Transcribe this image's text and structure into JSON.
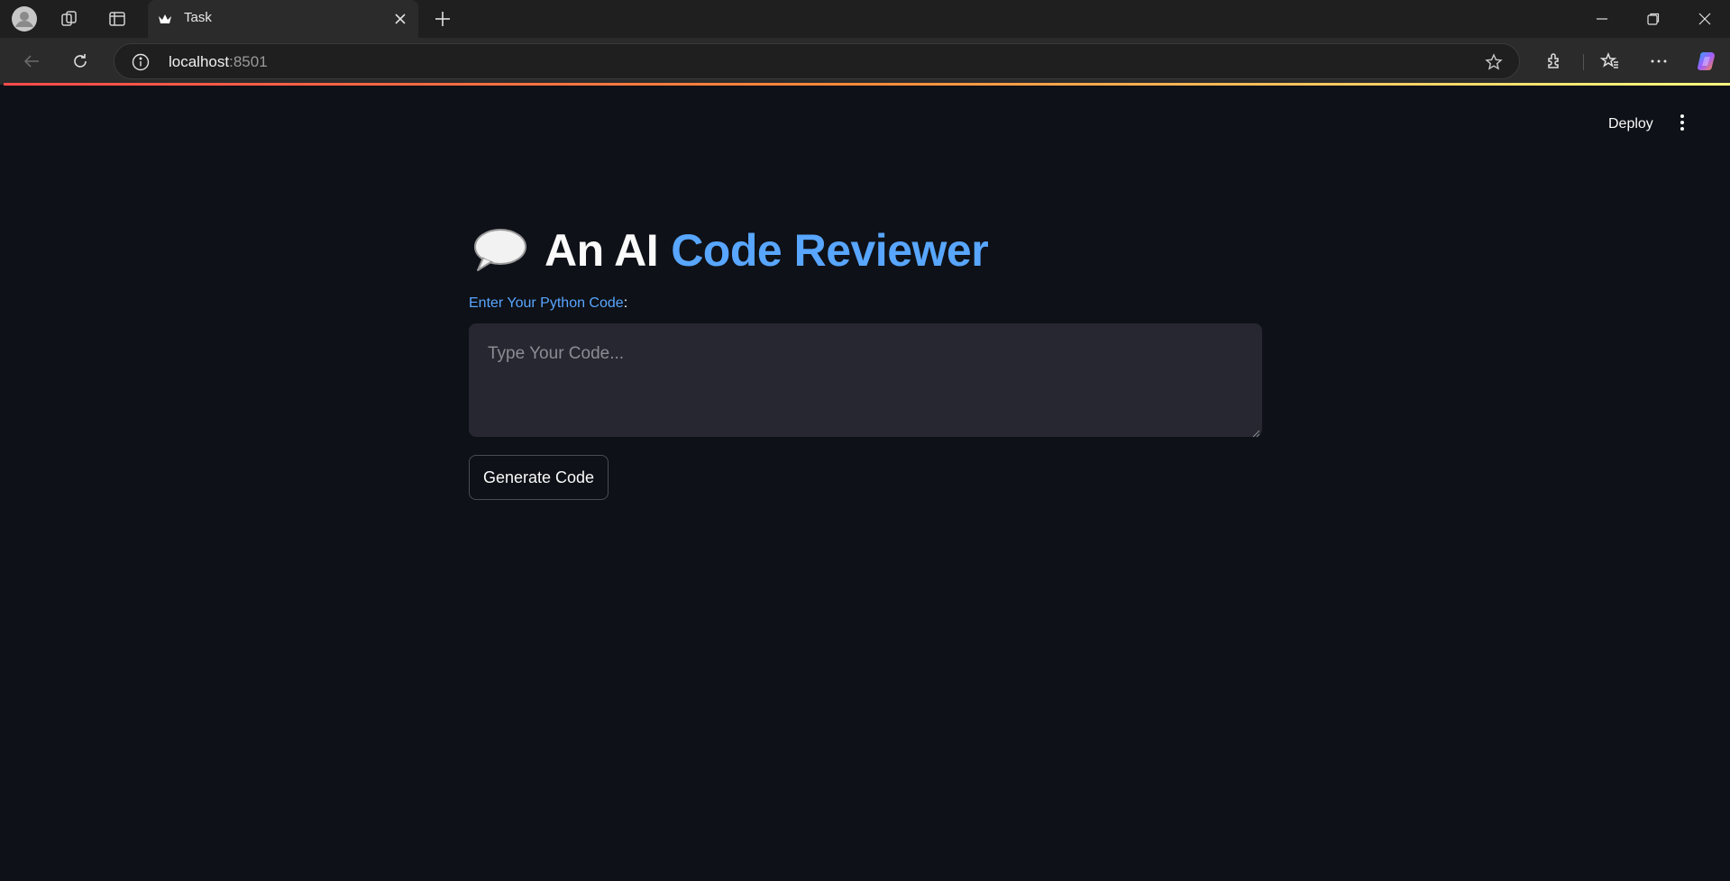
{
  "browser": {
    "tab": {
      "title": "Task"
    },
    "address": {
      "host": "localhost",
      "port": ":8501"
    }
  },
  "app": {
    "toolbar": {
      "deploy_label": "Deploy"
    },
    "title": {
      "emoji": "💬",
      "lead": "An AI",
      "accent": "Code Reviewer"
    },
    "input": {
      "label": "Enter Your Python Code",
      "label_suffix": ":",
      "placeholder": "Type Your Code...",
      "value": ""
    },
    "button": {
      "label": "Generate Code"
    }
  },
  "colors": {
    "background": "#0e1117",
    "accent": "#58a6ff",
    "input_bg": "#262730"
  },
  "icons": [
    "profile-icon",
    "workspaces-icon",
    "tab-actions-icon",
    "streamlit-favicon-icon",
    "close-icon",
    "plus-icon",
    "minimize-icon",
    "restore-icon",
    "window-close-icon",
    "back-arrow-icon",
    "refresh-icon",
    "info-icon",
    "star-icon",
    "extensions-icon",
    "favorites-icon",
    "more-icon",
    "copilot-icon",
    "kebab-icon"
  ]
}
